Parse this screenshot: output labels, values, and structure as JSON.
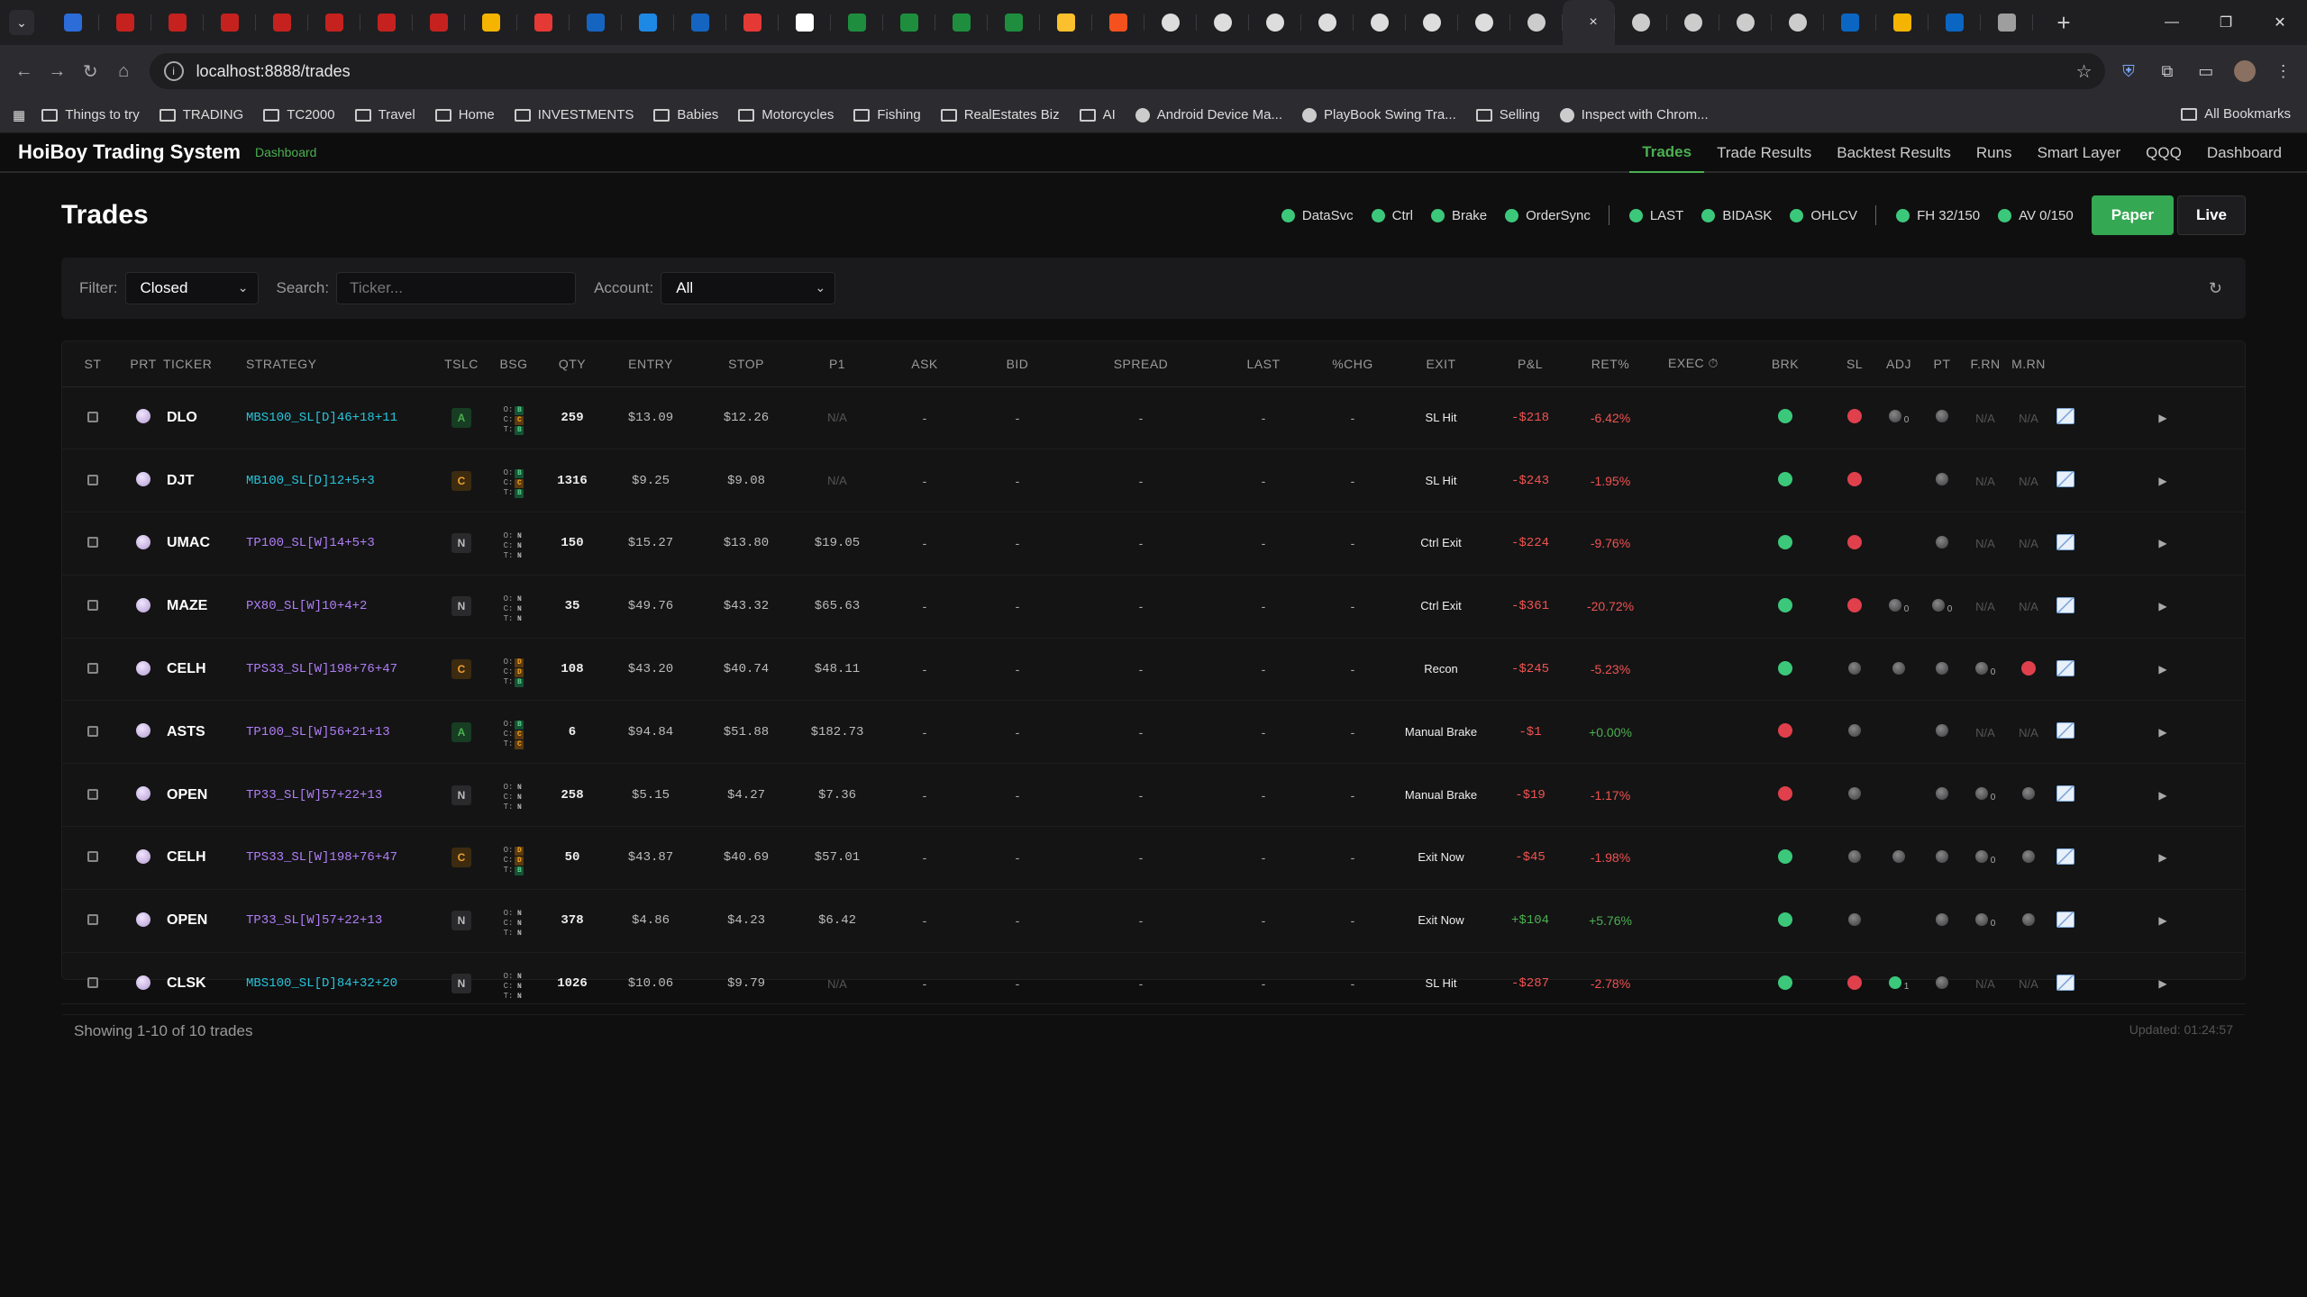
{
  "browser": {
    "tab_count": 38,
    "active_tab_close": "×",
    "new_tab": "+",
    "url": "localhost:8888/trades",
    "bookmarks": [
      {
        "label": "Things to try",
        "kind": "folder"
      },
      {
        "label": "TRADING",
        "kind": "folder"
      },
      {
        "label": "TC2000",
        "kind": "folder"
      },
      {
        "label": "Travel",
        "kind": "folder"
      },
      {
        "label": "Home",
        "kind": "folder"
      },
      {
        "label": "INVESTMENTS",
        "kind": "folder"
      },
      {
        "label": "Babies",
        "kind": "folder"
      },
      {
        "label": "Motorcycles",
        "kind": "folder"
      },
      {
        "label": "Fishing",
        "kind": "folder"
      },
      {
        "label": "RealEstates Biz",
        "kind": "folder"
      },
      {
        "label": "AI",
        "kind": "folder"
      },
      {
        "label": "Android Device Ma...",
        "kind": "site"
      },
      {
        "label": "PlayBook Swing Tra...",
        "kind": "site"
      },
      {
        "label": "Selling",
        "kind": "folder"
      },
      {
        "label": "Inspect with Chrom...",
        "kind": "site"
      }
    ],
    "all_bookmarks": "All Bookmarks"
  },
  "app": {
    "brand": "HoiBoy Trading System",
    "sub": "Dashboard",
    "nav": [
      "Trades",
      "Trade Results",
      "Backtest Results",
      "Runs",
      "Smart Layer",
      "QQQ",
      "Dashboard"
    ],
    "active_nav": "Trades"
  },
  "page": {
    "title": "Trades",
    "status_group1": [
      "DataSvc",
      "Ctrl",
      "Brake",
      "OrderSync"
    ],
    "status_group2": [
      "LAST",
      "BIDASK",
      "OHLCV"
    ],
    "status_group3": [
      "FH 32/150",
      "AV 0/150"
    ],
    "status_color": "#3cc87a",
    "paper_label": "Paper",
    "live_label": "Live"
  },
  "filters": {
    "filter_label": "Filter:",
    "filter_value": "Closed",
    "search_label": "Search:",
    "search_placeholder": "Ticker...",
    "account_label": "Account:",
    "account_value": "All",
    "refresh_icon": "↻"
  },
  "table": {
    "columns": [
      "ST",
      "PRT",
      "TICKER",
      "STRATEGY",
      "TSLC",
      "BSG",
      "QTY",
      "ENTRY",
      "STOP",
      "P1",
      "ASK",
      "BID",
      "SPREAD",
      "LAST",
      "%CHG",
      "EXIT",
      "P&L",
      "RET%",
      "EXEC ⏱",
      "BRK",
      "SL",
      "ADJ",
      "PT",
      "F.RN",
      "M.RN",
      "",
      ""
    ],
    "rows": [
      {
        "ticker": "DLO",
        "strategy": "MBS100_SL[D]46+18+11",
        "strat_color": "cyan",
        "tslc": "A",
        "bsg": [
          "B",
          "C",
          "B"
        ],
        "qty": "259",
        "entry": "$13.09",
        "stop": "$12.26",
        "p1": "N/A",
        "exit": "SL Hit",
        "pnl": "-$218",
        "ret": "-6.42%",
        "brk": "g",
        "sl": "r",
        "adj": "0",
        "pt": "k",
        "frn": "N/A",
        "mrn": "N/A"
      },
      {
        "ticker": "DJT",
        "strategy": "MB100_SL[D]12+5+3",
        "strat_color": "cyan",
        "tslc": "C",
        "bsg": [
          "B",
          "C",
          "B"
        ],
        "qty": "1316",
        "entry": "$9.25",
        "stop": "$9.08",
        "p1": "N/A",
        "exit": "SL Hit",
        "pnl": "-$243",
        "ret": "-1.95%",
        "brk": "g",
        "sl": "r",
        "adj": "",
        "pt": "k",
        "frn": "N/A",
        "mrn": "N/A"
      },
      {
        "ticker": "UMAC",
        "strategy": "TP100_SL[W]14+5+3",
        "strat_color": "purple",
        "tslc": "N",
        "bsg": [
          "N",
          "N",
          "N"
        ],
        "qty": "150",
        "entry": "$15.27",
        "stop": "$13.80",
        "p1": "$19.05",
        "exit": "Ctrl Exit",
        "pnl": "-$224",
        "ret": "-9.76%",
        "brk": "g",
        "sl": "r",
        "adj": "",
        "pt": "k",
        "frn": "N/A",
        "mrn": "N/A"
      },
      {
        "ticker": "MAZE",
        "strategy": "PX80_SL[W]10+4+2",
        "strat_color": "purple",
        "tslc": "N",
        "bsg": [
          "N",
          "N",
          "N"
        ],
        "qty": "35",
        "entry": "$49.76",
        "stop": "$43.32",
        "p1": "$65.63",
        "exit": "Ctrl Exit",
        "pnl": "-$361",
        "ret": "-20.72%",
        "brk": "g",
        "sl": "r",
        "adj": "0",
        "pt": "k0",
        "frn": "N/A",
        "mrn": "N/A"
      },
      {
        "ticker": "CELH",
        "strategy": "TPS33_SL[W]198+76+47",
        "strat_color": "purple",
        "tslc": "C",
        "bsg": [
          "D",
          "D",
          "B"
        ],
        "qty": "108",
        "entry": "$43.20",
        "stop": "$40.74",
        "p1": "$48.11",
        "exit": "Recon",
        "pnl": "-$245",
        "ret": "-5.23%",
        "brk": "g",
        "sl": "k",
        "adj": "k",
        "pt": "k",
        "frn": "0",
        "mrn": "r"
      },
      {
        "ticker": "ASTS",
        "strategy": "TP100_SL[W]56+21+13",
        "strat_color": "purple",
        "tslc": "A",
        "bsg": [
          "B",
          "C",
          "C"
        ],
        "qty": "6",
        "entry": "$94.84",
        "stop": "$51.88",
        "p1": "$182.73",
        "exit": "Manual Brake",
        "pnl": "-$1",
        "ret": "+0.00%",
        "brk": "r",
        "sl": "k",
        "adj": "",
        "pt": "k",
        "frn": "N/A",
        "mrn": "N/A"
      },
      {
        "ticker": "OPEN",
        "strategy": "TP33_SL[W]57+22+13",
        "strat_color": "purple",
        "tslc": "N",
        "bsg": [
          "N",
          "N",
          "N"
        ],
        "qty": "258",
        "entry": "$5.15",
        "stop": "$4.27",
        "p1": "$7.36",
        "exit": "Manual Brake",
        "pnl": "-$19",
        "ret": "-1.17%",
        "brk": "r",
        "sl": "k",
        "adj": "",
        "pt": "k",
        "frn": "0",
        "mrn": "k"
      },
      {
        "ticker": "CELH",
        "strategy": "TPS33_SL[W]198+76+47",
        "strat_color": "purple",
        "tslc": "C",
        "bsg": [
          "D",
          "D",
          "B"
        ],
        "qty": "50",
        "entry": "$43.87",
        "stop": "$40.69",
        "p1": "$57.01",
        "exit": "Exit Now",
        "pnl": "-$45",
        "ret": "-1.98%",
        "brk": "g",
        "sl": "k",
        "adj": "k",
        "pt": "k",
        "frn": "0",
        "mrn": "k"
      },
      {
        "ticker": "OPEN",
        "strategy": "TP33_SL[W]57+22+13",
        "strat_color": "purple",
        "tslc": "N",
        "bsg": [
          "N",
          "N",
          "N"
        ],
        "qty": "378",
        "entry": "$4.86",
        "stop": "$4.23",
        "p1": "$6.42",
        "exit": "Exit Now",
        "pnl": "+$104",
        "ret": "+5.76%",
        "brk": "g",
        "sl": "k",
        "adj": "",
        "pt": "k",
        "frn": "0",
        "mrn": "k"
      },
      {
        "ticker": "CLSK",
        "strategy": "MBS100_SL[D]84+32+20",
        "strat_color": "cyan",
        "tslc": "N",
        "bsg": [
          "N",
          "N",
          "N"
        ],
        "qty": "1026",
        "entry": "$10.06",
        "stop": "$9.79",
        "p1": "N/A",
        "exit": "SL Hit",
        "pnl": "-$287",
        "ret": "-2.78%",
        "brk": "g",
        "sl": "r",
        "adj": "g1",
        "pt": "k",
        "frn": "N/A",
        "mrn": "N/A"
      }
    ]
  },
  "footer": {
    "showing": "Showing 1-10 of 10 trades",
    "updated": "Updated: 01:24:57"
  }
}
